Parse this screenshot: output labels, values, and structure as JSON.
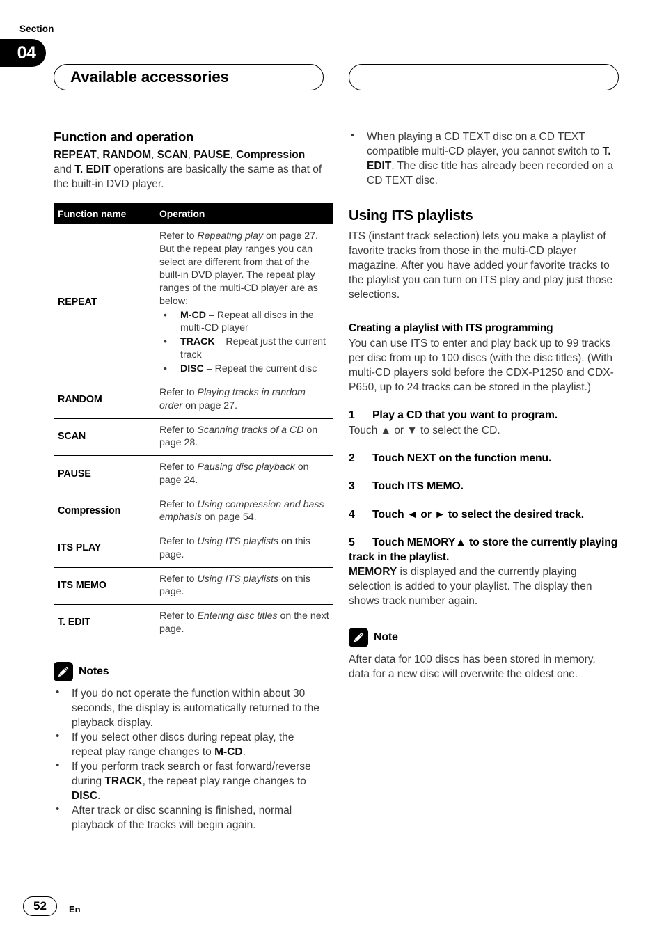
{
  "header": {
    "section_label": "Section",
    "section_number": "04",
    "title": "Available accessories",
    "right_pill_text": ""
  },
  "left_column": {
    "heading": "Function and operation",
    "intro": {
      "prefix_bold_1": "REPEAT",
      "sep_1": ", ",
      "prefix_bold_2": "RANDOM",
      "sep_2": ", ",
      "prefix_bold_3": "SCAN",
      "sep_3": ", ",
      "prefix_bold_4": "PAUSE",
      "sep_4": ", ",
      "prefix_bold_5": "Compression",
      "mid": " and ",
      "prefix_bold_6": "T. EDIT",
      "tail": " operations are basically the same as that of the built-in DVD player."
    },
    "table": {
      "headers": [
        "Function name",
        "Operation"
      ],
      "rows": [
        {
          "name": "REPEAT",
          "operation_lead": "Refer to ",
          "operation_italic": "Repeating play",
          "operation_tail": " on page 27. But the repeat play ranges you can select are different from that of the built-in DVD player. The repeat play ranges of the multi-CD player are as below:",
          "bullets": [
            {
              "term": "M-CD",
              "desc": " – Repeat all discs in the multi-CD player"
            },
            {
              "term": "TRACK",
              "desc": " – Repeat just the current track"
            },
            {
              "term": "DISC",
              "desc": " – Repeat the current disc"
            }
          ]
        },
        {
          "name": "RANDOM",
          "operation_lead": "Refer to ",
          "operation_italic": "Playing tracks in random order",
          "operation_tail": " on page 27."
        },
        {
          "name": "SCAN",
          "operation_lead": "Refer to ",
          "operation_italic": "Scanning tracks of a CD",
          "operation_tail": " on page 28."
        },
        {
          "name": "PAUSE",
          "operation_lead": "Refer to ",
          "operation_italic": "Pausing disc playback",
          "operation_tail": " on page 24."
        },
        {
          "name": "Compression",
          "operation_lead": "Refer to ",
          "operation_italic": "Using compression and bass emphasis",
          "operation_tail": " on page 54."
        },
        {
          "name": "ITS PLAY",
          "operation_lead": "Refer to ",
          "operation_italic": "Using ITS playlists",
          "operation_tail": " on this page."
        },
        {
          "name": "ITS MEMO",
          "operation_lead": "Refer to ",
          "operation_italic": "Using ITS playlists",
          "operation_tail": " on this page."
        },
        {
          "name": "T. EDIT",
          "operation_lead": "Refer to ",
          "operation_italic": "Entering disc titles",
          "operation_tail": " on the next page."
        }
      ]
    },
    "notes": {
      "icon": "pencil-icon",
      "title": "Notes",
      "items": [
        {
          "text": "If you do not operate the function within about 30 seconds, the display is automatically returned to the playback display."
        },
        {
          "lead": "If you select other discs during repeat play, the repeat play range changes to ",
          "bold": "M-CD",
          "tail": "."
        },
        {
          "lead": "If you perform track search or fast forward/reverse during ",
          "bold": "TRACK",
          "mid": ", the repeat play range changes to ",
          "bold2": "DISC",
          "tail": "."
        },
        {
          "text": "After track or disc scanning is finished, normal playback of the tracks will begin again."
        }
      ]
    }
  },
  "right_column": {
    "top_bullet": {
      "lead": "When playing a CD TEXT disc on a CD TEXT compatible multi-CD player, you cannot switch to ",
      "bold": "T. EDIT",
      "tail": ". The disc title has already been recorded on a CD TEXT disc."
    },
    "heading": "Using ITS playlists",
    "intro": "ITS (instant track selection) lets you make a playlist of favorite tracks from those in the multi-CD player magazine. After you have added your favorite tracks to the playlist you can turn on ITS play and play just those selections.",
    "subheading": "Creating a playlist with ITS programming",
    "sub_intro": "You can use ITS to enter and play back up to 99 tracks per disc from up to 100 discs (with the disc titles). (With multi-CD players sold before the CDX-P1250 and CDX-P650, up to 24 tracks can be stored in the playlist.)",
    "steps": [
      {
        "num": "1",
        "title": "Play a CD that you want to program.",
        "body": "Touch ▲ or ▼ to select the CD."
      },
      {
        "num": "2",
        "title": "Touch NEXT on the function menu.",
        "body": ""
      },
      {
        "num": "3",
        "title": "Touch ITS MEMO.",
        "body": ""
      },
      {
        "num": "4",
        "title": "Touch ◄ or ► to select the desired track.",
        "body": ""
      },
      {
        "num": "5",
        "title": "Touch MEMORY▲ to store the currently playing track in the playlist.",
        "body_bold": "MEMORY",
        "body": " is displayed and the currently playing selection is added to your playlist. The display then shows track number again."
      }
    ],
    "note": {
      "icon": "pencil-icon",
      "title": "Note",
      "text": "After data for 100 discs has been stored in memory, data for a new disc will overwrite the oldest one."
    }
  },
  "footer": {
    "page_number": "52",
    "language_code": "En"
  },
  "colors": {
    "ink": "#000000",
    "body_text": "#3a3a3a",
    "table_header_bg": "#000000",
    "table_header_fg": "#ffffff"
  }
}
